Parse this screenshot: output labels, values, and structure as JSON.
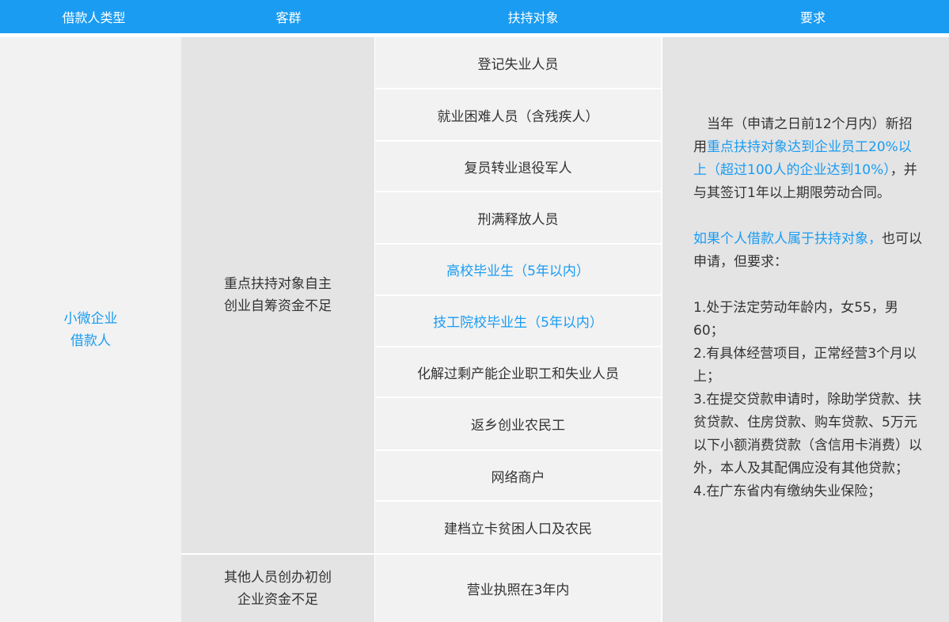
{
  "header": {
    "col1": "借款人类型",
    "col2": "客群",
    "col3": "扶持对象",
    "col4": "要求"
  },
  "colors": {
    "header_bg": "#1a9cf2",
    "highlight": "#1a9cf2"
  },
  "borrower": {
    "line1": "小微企业",
    "line2": "借款人"
  },
  "groups": {
    "a": {
      "line1": "重点扶持对象自主",
      "line2": "创业自筹资金不足"
    },
    "b": {
      "line1": "其他人员创办初创",
      "line2": "企业资金不足"
    }
  },
  "targets": [
    "登记失业人员",
    "就业困难人员（含残疾人）",
    "复员转业退役军人",
    "刑满释放人员",
    "高校毕业生（5年以内）",
    "技工院校毕业生（5年以内）",
    "化解过剩产能企业职工和失业人员",
    "返乡创业农民工",
    "网络商户",
    "建档立卡贫困人口及农民",
    "营业执照在3年内"
  ],
  "requirements": {
    "p1_a": "　当年（申请之日前12个月内）新招用",
    "p1_b": "重点扶持对象达到企业员工20%以上（超过100人的企业达到10%）",
    "p1_c": "，并与其签订1年以上期限劳动合同。",
    "p2_a": "如果个人借款人属于扶持对象，",
    "p2_b": "也可以申请，但要求：",
    "items": [
      "1.处于法定劳动年龄内，女55，男60；",
      "2.有具体经营项目，正常经营3个月以上；",
      "3.在提交贷款申请时，除助学贷款、扶贫贷款、住房贷款、购车贷款、5万元以下小额消费贷款（含信用卡消费）以外，本人及其配偶应没有其他贷款；",
      "4.在广东省内有缴纳失业保险；"
    ]
  }
}
